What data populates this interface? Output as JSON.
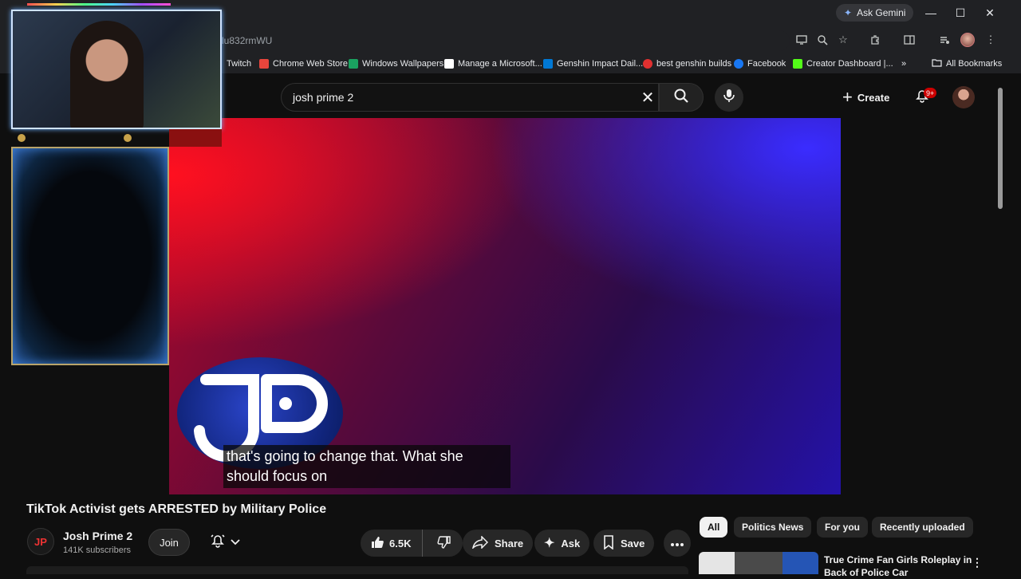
{
  "browser": {
    "ask_gemini": "Ask Gemini",
    "url_fragment": "lu832rmWU",
    "window_controls": {
      "minimize": "—",
      "maximize": "☐",
      "close": "✕"
    },
    "bookmarks": [
      {
        "label": "Twitch",
        "color": "#9146ff"
      },
      {
        "label": "Chrome Web Store",
        "color": "#e8453c"
      },
      {
        "label": "Windows Wallpapers",
        "color": "#1aa260"
      },
      {
        "label": "Manage a Microsoft...",
        "color": "#ffffff"
      },
      {
        "label": "Genshin Impact Dail...",
        "color": "#0078d4"
      },
      {
        "label": "best genshin builds",
        "color": "#e03030"
      },
      {
        "label": "Facebook",
        "color": "#1877f2"
      },
      {
        "label": "Creator Dashboard |...",
        "color": "#53fc18"
      }
    ],
    "bookmarks_overflow": "»",
    "all_bookmarks": "All Bookmarks"
  },
  "youtube": {
    "search_value": "josh prime 2",
    "create_label": "Create",
    "notification_badge": "9+"
  },
  "video": {
    "caption_line1": "that's going to change that. What she",
    "caption_line2": "should focus on",
    "title": "TikTok Activist gets ARRESTED by Military Police"
  },
  "channel": {
    "avatar_text": "JP",
    "name": "Josh Prime 2",
    "subscribers": "141K subscribers",
    "join_label": "Join"
  },
  "actions": {
    "likes": "6.5K",
    "share": "Share",
    "ask": "Ask",
    "save": "Save"
  },
  "chips": [
    "All",
    "Politics News",
    "For you",
    "Recently uploaded"
  ],
  "recommendation": {
    "title": "True Crime Fan Girls Roleplay in Back of Police Car"
  },
  "colors": {
    "accent_red": "#cc0000",
    "youtube_bg": "#0f0f0f",
    "chrome_bg": "#202124"
  }
}
